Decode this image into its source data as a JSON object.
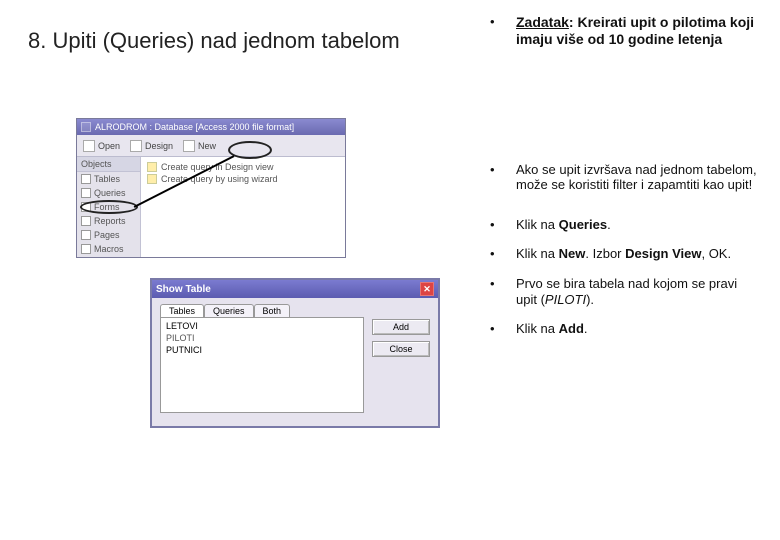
{
  "title": "8. Upiti (Queries) nad jednom tabelom",
  "bullets": {
    "task_label": "Zadatak",
    "task_rest": ": Kreirati upit o pilotima koji imaju više od 10 godine letenja",
    "b2": "Ako se upit izvršava nad jednom tabelom, može se koristiti filter i zapamtiti kao upit!",
    "b3_pre": "Klik na ",
    "b3_bold": "Queries",
    "b3_post": ".",
    "b4_pre": "Klik na ",
    "b4_bold1": "New",
    "b4_mid": ". Izbor ",
    "b4_bold2": "Design View",
    "b4_post": ", OK.",
    "b5_pre": "Prvo se bira tabela nad kojom se pravi upit (",
    "b5_it": "PILOTI",
    "b5_post": ").",
    "b6_pre": "Klik na ",
    "b6_bold": "Add",
    "b6_post": "."
  },
  "db": {
    "title": "ALRODROM : Database [Access 2000 file format]",
    "toolbar": {
      "open": "Open",
      "design": "Design",
      "new_": "New"
    },
    "sidebar_header": "Objects",
    "sidebar": [
      "Tables",
      "Queries",
      "Forms",
      "Reports",
      "Pages",
      "Macros"
    ],
    "list": [
      "Create query in Design view",
      "Create query by using wizard"
    ]
  },
  "dlg": {
    "title": "Show Table",
    "tabs": [
      "Tables",
      "Queries",
      "Both"
    ],
    "rows": [
      "LETOVI",
      "PILOTI",
      "PUTNICI"
    ],
    "buttons": {
      "add": "Add",
      "close": "Close"
    }
  }
}
